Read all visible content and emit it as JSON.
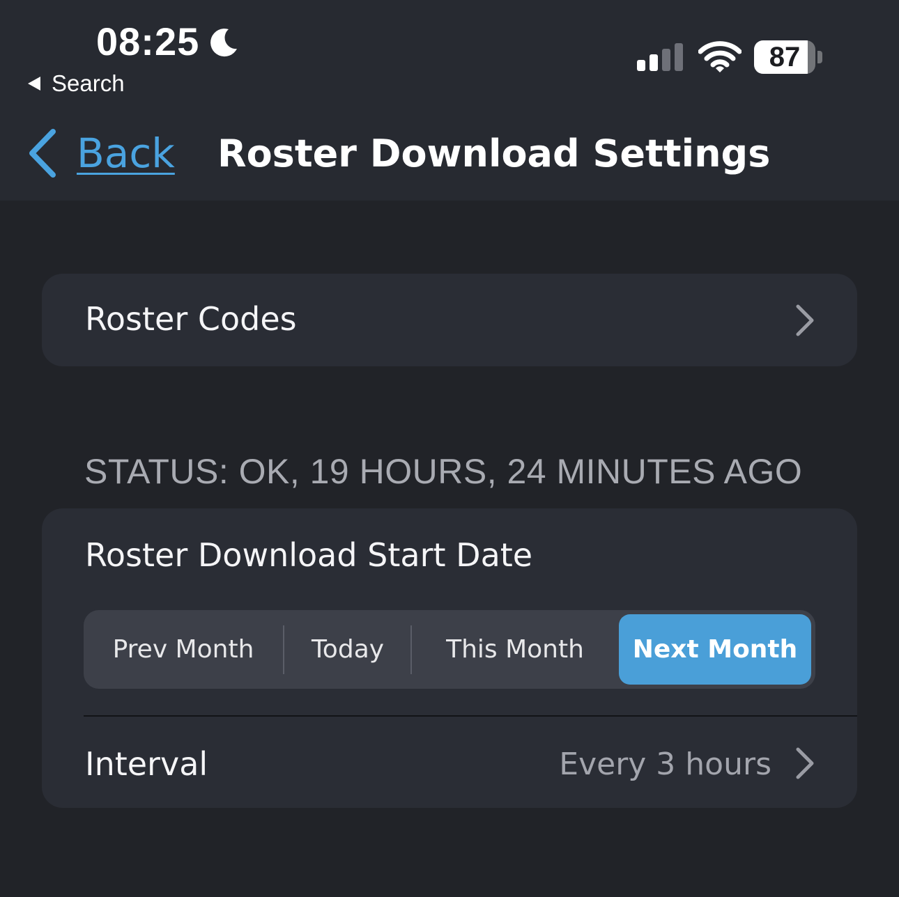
{
  "status_bar": {
    "time": "08:25",
    "back_app_label": "Search",
    "battery_level": "87",
    "battery_fraction": 0.87,
    "signal_bars_active": 2,
    "signal_bars_total": 4
  },
  "nav": {
    "back_label": "Back",
    "title": "Roster Download Settings"
  },
  "roster_codes": {
    "label": "Roster Codes"
  },
  "status_text": "STATUS: OK, 19 HOURS, 24 MINUTES AGO",
  "start_date": {
    "label": "Roster Download Start Date",
    "options": [
      "Prev Month",
      "Today",
      "This Month",
      "Next Month"
    ],
    "selected": "Next Month"
  },
  "interval": {
    "label": "Interval",
    "value": "Every 3 hours"
  },
  "colors": {
    "background": "#212328",
    "header": "#272a31",
    "card": "#2a2d35",
    "accent": "#4a9fd8",
    "link": "#4aa3e0",
    "secondary_text": "#a9abb2"
  }
}
